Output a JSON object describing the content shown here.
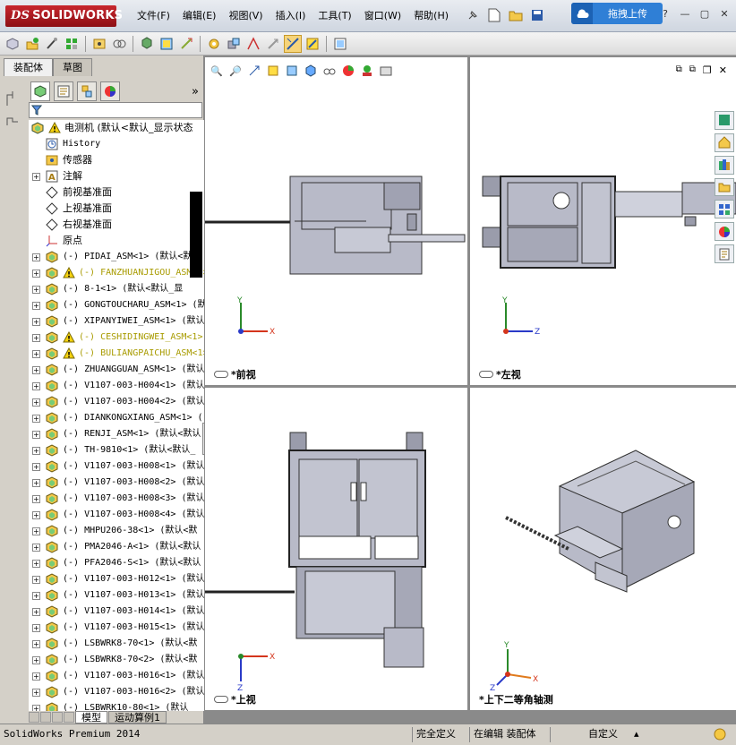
{
  "app": {
    "logo_text": "SOLIDWORKS",
    "logo_prefix": "DS"
  },
  "menu": [
    "文件(F)",
    "编辑(E)",
    "视图(V)",
    "插入(I)",
    "工具(T)",
    "窗口(W)",
    "帮助(H)"
  ],
  "upload_button": "拖拽上传",
  "left_panel": {
    "tabs": [
      "装配体",
      "草图"
    ],
    "active_tab": 0,
    "tree": [
      {
        "label": "电测机  (默认<默认_显示状态",
        "kind": "root",
        "warn": true,
        "cn": true
      },
      {
        "label": "History",
        "kind": "history"
      },
      {
        "label": "传感器",
        "kind": "sensor",
        "cn": true
      },
      {
        "label": "注解",
        "kind": "annot",
        "expand": true,
        "cn": true
      },
      {
        "label": "前视基准面",
        "kind": "plane",
        "cn": true
      },
      {
        "label": "上视基准面",
        "kind": "plane",
        "cn": true
      },
      {
        "label": "右视基准面",
        "kind": "plane",
        "cn": true
      },
      {
        "label": "原点",
        "kind": "origin",
        "cn": true
      },
      {
        "label": "(-) PIDAI_ASM<1> (默认<默认",
        "kind": "asm",
        "expand": true
      },
      {
        "label": "(-) FANZHUANJIGOU_ASM<1>",
        "kind": "asm",
        "expand": true,
        "warn": true
      },
      {
        "label": "(-) 8-1<1> (默认<默认_显",
        "kind": "asm",
        "expand": true
      },
      {
        "label": "(-) GONGTOUCHARU_ASM<1> (默",
        "kind": "asm",
        "expand": true
      },
      {
        "label": "(-) XIPANYIWEI_ASM<1> (默认",
        "kind": "asm",
        "expand": true
      },
      {
        "label": "(-) CESHIDINGWEI_ASM<1>",
        "kind": "asm",
        "expand": true,
        "warn": true
      },
      {
        "label": "(-) BULIANGPAICHU_ASM<1>",
        "kind": "asm",
        "expand": true,
        "warn": true
      },
      {
        "label": "(-) ZHUANGGUAN_ASM<1> (默认",
        "kind": "asm",
        "expand": true
      },
      {
        "label": "(-) V1107-003-H004<1> (默认",
        "kind": "asm",
        "expand": true
      },
      {
        "label": "(-) V1107-003-H004<2> (默认",
        "kind": "asm",
        "expand": true
      },
      {
        "label": "(-) DIANKONGXIANG_ASM<1> (",
        "kind": "asm",
        "expand": true
      },
      {
        "label": "(-) RENJI_ASM<1> (默认<默认",
        "kind": "asm",
        "expand": true
      },
      {
        "label": "(-) TH-9810<1> (默认<默认_",
        "kind": "asm",
        "expand": true
      },
      {
        "label": "(-) V1107-003-H008<1> (默认",
        "kind": "asm",
        "expand": true
      },
      {
        "label": "(-) V1107-003-H008<2> (默认",
        "kind": "asm",
        "expand": true
      },
      {
        "label": "(-) V1107-003-H008<3> (默认",
        "kind": "asm",
        "expand": true
      },
      {
        "label": "(-) V1107-003-H008<4> (默认",
        "kind": "asm",
        "expand": true
      },
      {
        "label": "(-) MHPU206-38<1> (默认<默",
        "kind": "asm",
        "expand": true
      },
      {
        "label": "(-) PMA2046-A<1> (默认<默认",
        "kind": "asm",
        "expand": true
      },
      {
        "label": "(-) PFA2046-S<1> (默认<默认",
        "kind": "asm",
        "expand": true
      },
      {
        "label": "(-) V1107-003-H012<1> (默认",
        "kind": "asm",
        "expand": true
      },
      {
        "label": "(-) V1107-003-H013<1> (默认",
        "kind": "asm",
        "expand": true
      },
      {
        "label": "(-) V1107-003-H014<1> (默认",
        "kind": "asm",
        "expand": true
      },
      {
        "label": "(-) V1107-003-H015<1> (默认",
        "kind": "asm",
        "expand": true
      },
      {
        "label": "(-) LSBWRK8-70<1> (默认<默",
        "kind": "asm",
        "expand": true
      },
      {
        "label": "(-) LSBWRK8-70<2> (默认<默",
        "kind": "asm",
        "expand": true
      },
      {
        "label": "(-) V1107-003-H016<1> (默认",
        "kind": "asm",
        "expand": true
      },
      {
        "label": "(-) V1107-003-H016<2> (默认",
        "kind": "asm",
        "expand": true
      },
      {
        "label": "(-) LSBWRK10-80<1> (默认",
        "kind": "asm",
        "expand": true
      }
    ],
    "bottom_tabs": [
      "模型",
      "运动算例1"
    ],
    "active_bottom_tab": 0
  },
  "viewports": [
    {
      "label": "*前视",
      "axes": [
        "Y",
        "X"
      ]
    },
    {
      "label": "*左视",
      "axes": [
        "Y",
        "Z"
      ]
    },
    {
      "label": "*上视",
      "axes": [
        "X",
        "Z"
      ]
    },
    {
      "label": "*上下二等角轴测",
      "axes": [
        "Y",
        "X",
        "Z"
      ]
    }
  ],
  "status": {
    "product": "SolidWorks Premium 2014",
    "definition": "完全定义",
    "editing": "在编辑 装配体",
    "units": "自定义"
  },
  "colors": {
    "warning_text": "#a89b00",
    "accent_red": "#c8262d",
    "upload_blue": "#2f7fd6",
    "model_fill": "#b8bac8"
  }
}
